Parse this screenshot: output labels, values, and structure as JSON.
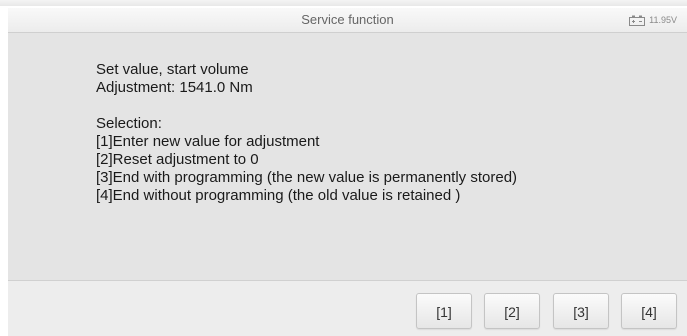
{
  "header": {
    "title": "Service function",
    "battery_icon": "battery-icon",
    "voltage": "11.95V"
  },
  "message": {
    "line1": "Set value, start volume",
    "line2": "Adjustment: 1541.0 Nm",
    "selection_heading": "Selection:",
    "options": [
      "[1]Enter new value for adjustment",
      "[2]Reset adjustment to 0",
      "[3]End with programming (the new value is permanently stored)",
      "[4]End without programming (the old value is retained )"
    ]
  },
  "buttons": [
    "[1]",
    "[2]",
    "[3]",
    "[4]"
  ]
}
